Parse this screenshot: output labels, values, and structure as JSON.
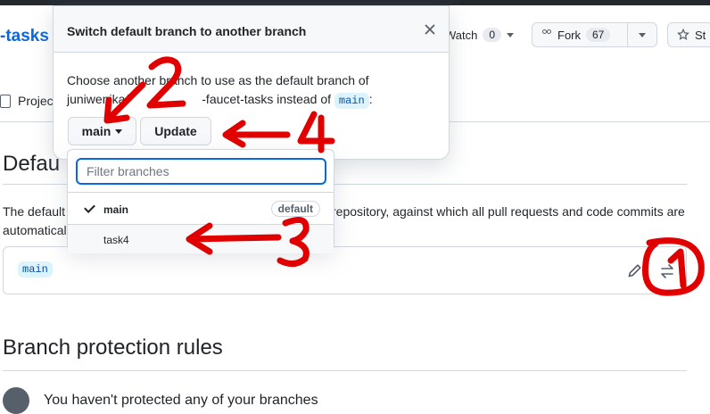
{
  "repo": {
    "name_fragment": "-tasks",
    "tabs_fragment": "Projec",
    "watch_label": "Watch",
    "watch_count": "0",
    "fork_label": "Fork",
    "fork_count": "67",
    "star_fragment": "St"
  },
  "settings": {
    "default_branch_title": "Defau",
    "description_left_line1": "The default",
    "description_left_line2": "automatical",
    "description_right": "repository, against which all pull requests and code commits are",
    "current_branch": "main",
    "protection_title": "Branch protection rules",
    "protection_empty": "You haven't protected any of your branches"
  },
  "modal": {
    "title": "Switch default branch to another branch",
    "body_text_1": "Choose another branch to use as the default branch of",
    "body_text_2": "juniwenika/",
    "body_text_3": "-faucet-tasks instead of",
    "body_current_branch": "main",
    "body_colon": ":",
    "branch_button_label": "main",
    "update_button_label": "Update"
  },
  "dropdown": {
    "filter_placeholder": "Filter branches",
    "items": [
      {
        "label": "main",
        "badge": "default",
        "selected": true
      },
      {
        "label": "task4",
        "badge": "",
        "selected": false
      }
    ]
  },
  "annotations": {
    "color": "#e00000",
    "labels": [
      "1",
      "2",
      "3",
      "4"
    ]
  },
  "colors": {
    "link": "#0969da",
    "border": "#d0d7de",
    "button_bg": "#f6f8fa",
    "focus": "#0969da",
    "code_bg": "#ddf4ff"
  }
}
